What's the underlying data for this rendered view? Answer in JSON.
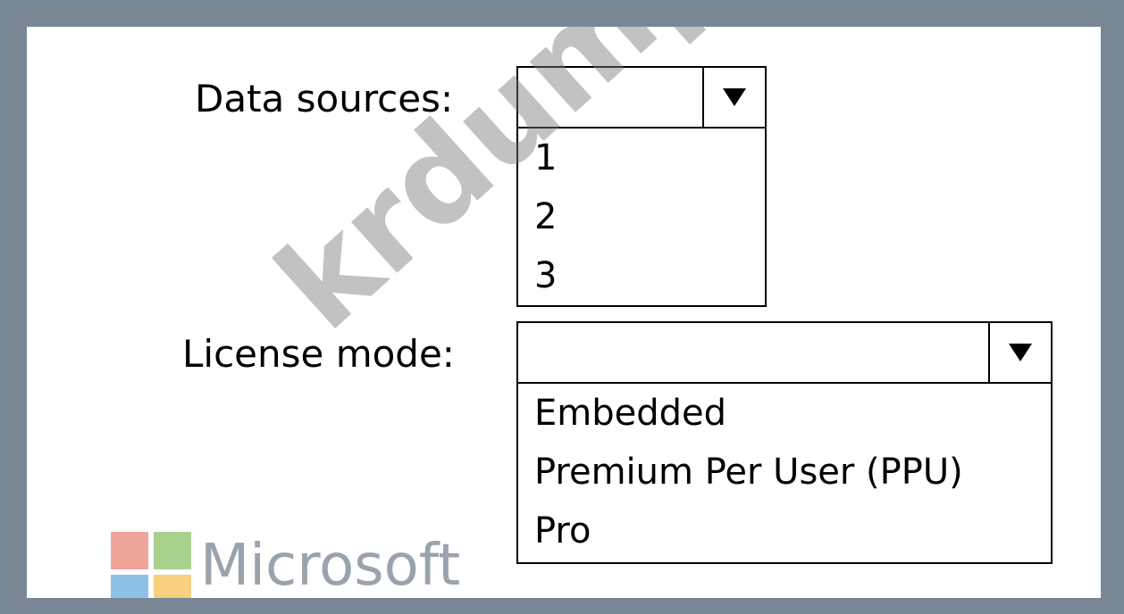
{
  "fields": {
    "data_sources": {
      "label": "Data sources:",
      "selected": "",
      "options": [
        "1",
        "2",
        "3"
      ]
    },
    "license_mode": {
      "label": "License mode:",
      "selected": "",
      "options": [
        "Embedded",
        "Premium Per User (PPU)",
        "Pro"
      ]
    }
  },
  "watermark": "krdump.com",
  "logo": {
    "text": "Microsoft",
    "icon": "microsoft-logo-icon",
    "colors": [
      "#f0a49a",
      "#a9d18e",
      "#8ec1e8",
      "#f8cf7d"
    ]
  }
}
